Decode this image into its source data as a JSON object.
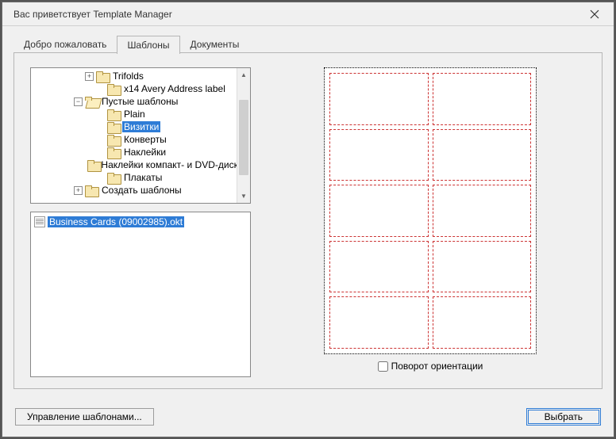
{
  "window": {
    "title": "Вас приветствует Template Manager"
  },
  "tabs": {
    "welcome": "Добро пожаловать",
    "templates": "Шаблоны",
    "documents": "Документы",
    "active": "templates"
  },
  "tree": {
    "items": [
      {
        "indent": 68,
        "exp": "plus",
        "icon": "folder",
        "label": "Trifolds"
      },
      {
        "indent": 82,
        "exp": null,
        "icon": "folder",
        "label": "x14 Avery Address label"
      },
      {
        "indent": 54,
        "exp": "minus",
        "icon": "folder-open",
        "label": "Пустые шаблоны"
      },
      {
        "indent": 82,
        "exp": null,
        "icon": "folder",
        "label": "Plain"
      },
      {
        "indent": 82,
        "exp": null,
        "icon": "folder",
        "label": "Визитки",
        "selected": true
      },
      {
        "indent": 82,
        "exp": null,
        "icon": "folder",
        "label": "Конверты"
      },
      {
        "indent": 82,
        "exp": null,
        "icon": "folder",
        "label": "Наклейки"
      },
      {
        "indent": 82,
        "exp": null,
        "icon": "folder",
        "label": "Наклейки компакт- и DVD-дисков"
      },
      {
        "indent": 82,
        "exp": null,
        "icon": "folder",
        "label": "Плакаты"
      },
      {
        "indent": 54,
        "exp": "plus",
        "icon": "folder",
        "label": "Создать шаблоны"
      }
    ]
  },
  "filelist": {
    "items": [
      {
        "label": "Business Cards (09002985).okt",
        "selected": true
      }
    ]
  },
  "preview": {
    "rotate_label": "Поворот ориентации",
    "rotate_checked": false,
    "grid_cols": 2,
    "grid_rows": 5
  },
  "buttons": {
    "manage": "Управление шаблонами...",
    "choose": "Выбрать"
  }
}
